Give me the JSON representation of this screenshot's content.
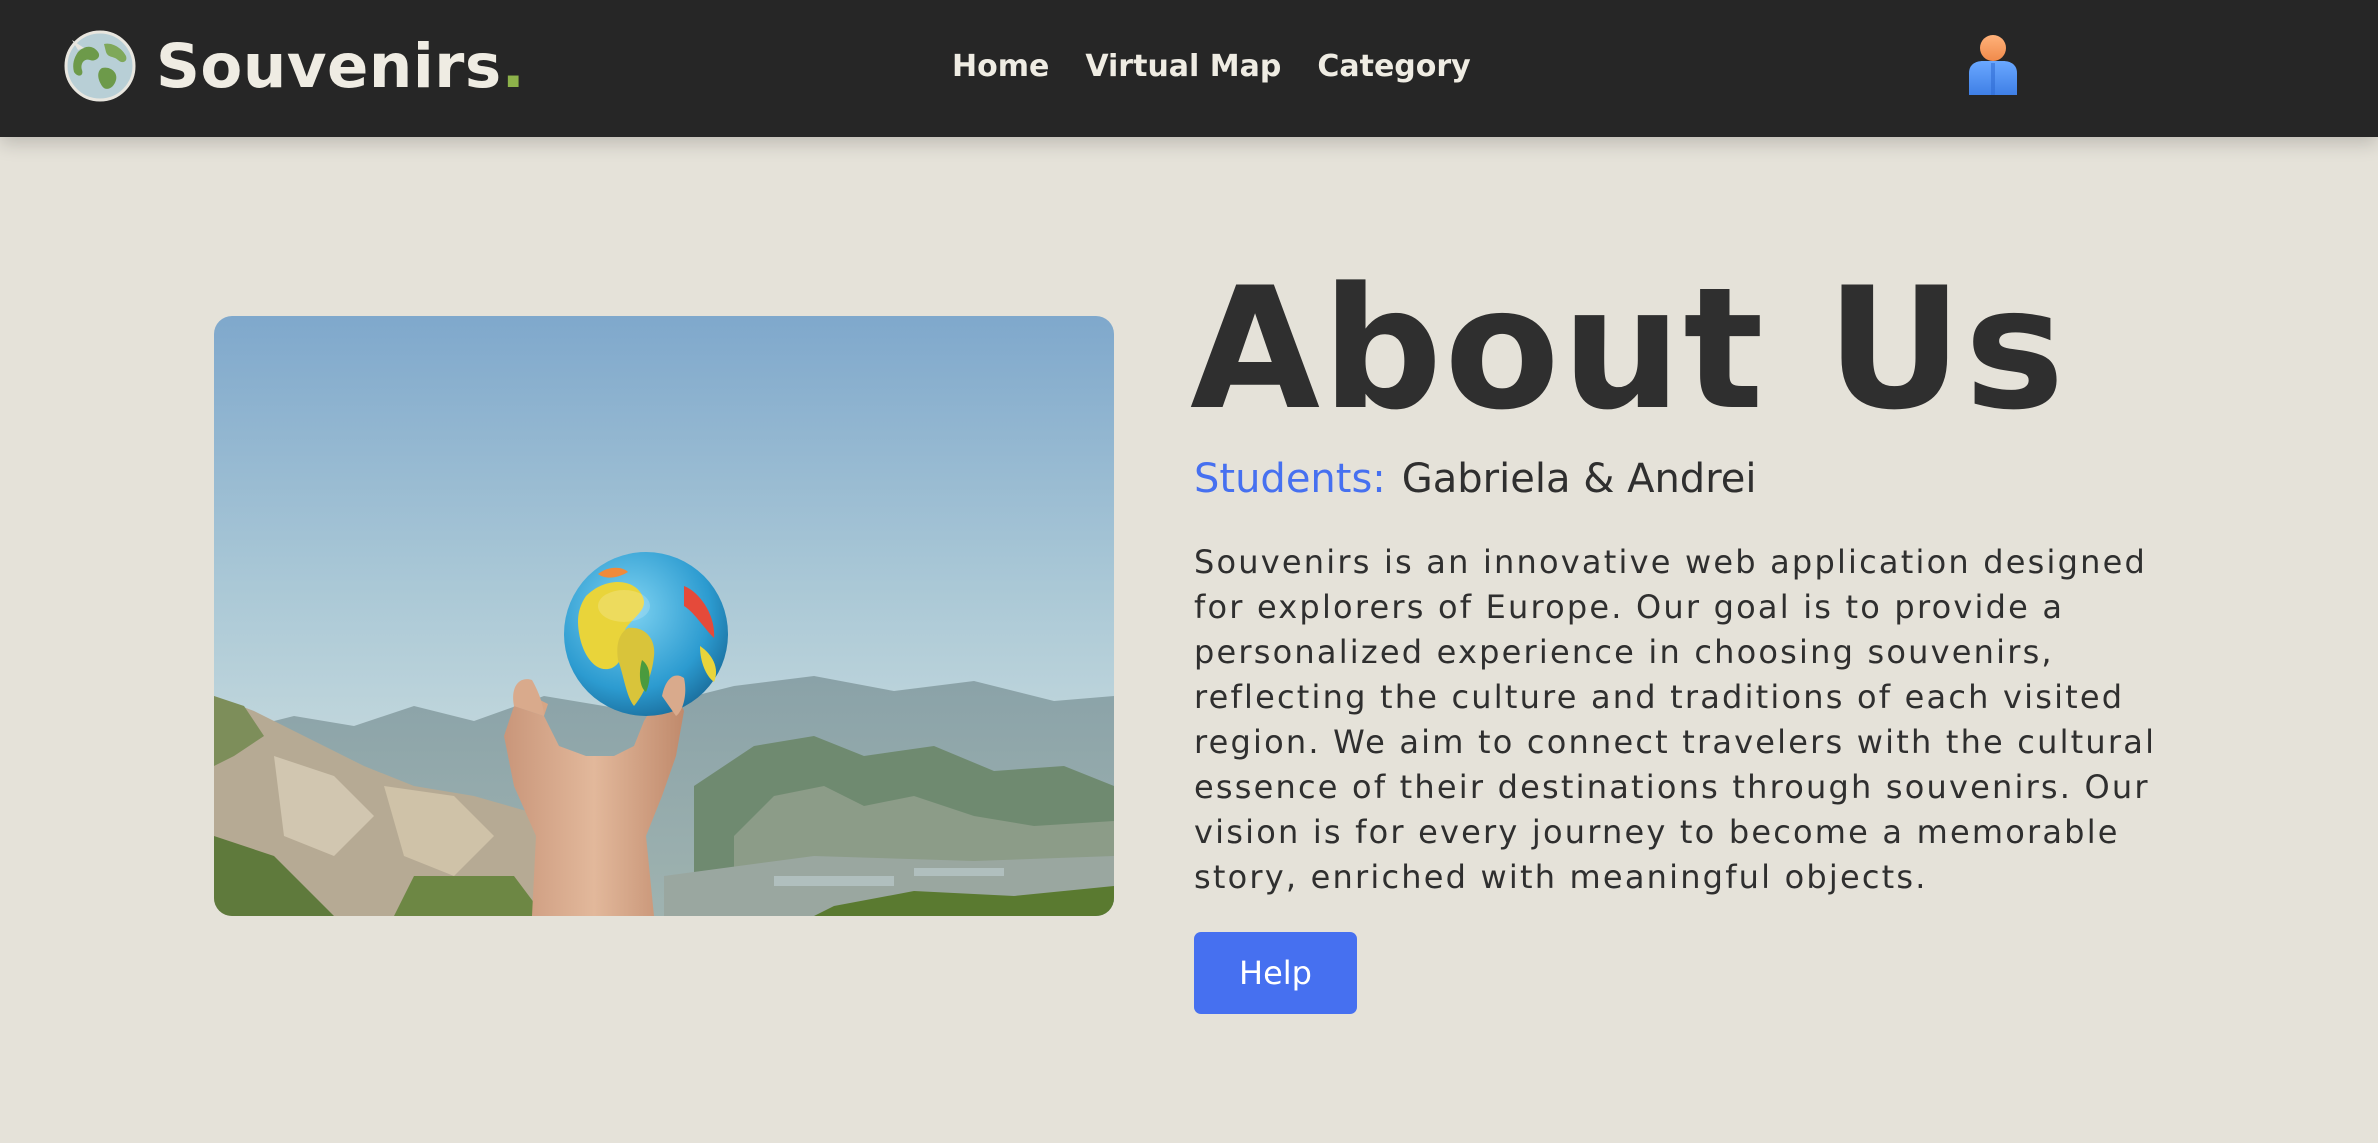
{
  "header": {
    "brand": {
      "name": "Souvenirs",
      "dot": ".",
      "icon": "globe-icon"
    },
    "nav": [
      {
        "label": "Home"
      },
      {
        "label": "Virtual Map"
      },
      {
        "label": "Category"
      }
    ],
    "user_icon": "user-icon"
  },
  "about": {
    "image": "hand-holding-globe-photo",
    "title": "About Us",
    "students_label": "Students:",
    "students_names": "Gabriela & Andrei",
    "description": "Souvenirs is an innovative web application designed for explorers of Europe. Our goal is to provide a personalized experience in choosing souvenirs, reflecting the culture and traditions of each visited region. We aim to connect travelers with the cultural essence of their destinations through souvenirs. Our vision is for every journey to become a memorable story, enriched with meaningful objects.",
    "help_button": "Help"
  },
  "colors": {
    "navbar": "#262626",
    "background": "#e5e2d9",
    "accent": "#4670f0",
    "brand_dot": "#8db24a",
    "text": "#2f2f2f"
  }
}
